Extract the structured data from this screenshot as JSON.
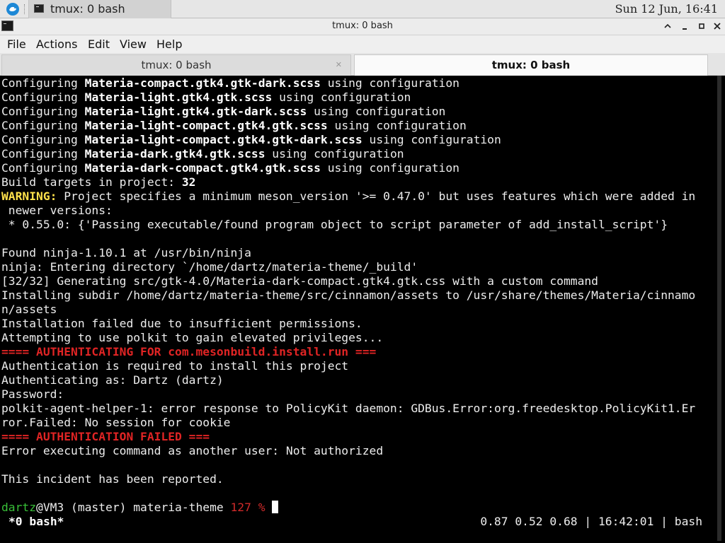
{
  "panel": {
    "launcher_icon": "xfce-launcher-icon",
    "task_title": "tmux: 0 bash",
    "clock": "Sun 12 Jun, 16:41"
  },
  "window": {
    "title": "tmux: 0 bash",
    "buttons": [
      "minimize",
      "maximize",
      "close"
    ]
  },
  "menu": {
    "items": [
      "File",
      "Actions",
      "Edit",
      "View",
      "Help"
    ]
  },
  "tabs": [
    {
      "label": "tmux: 0 bash",
      "active": false
    },
    {
      "label": "tmux: 0 bash",
      "active": true
    }
  ],
  "terminal": {
    "lines": [
      {
        "segments": [
          {
            "t": "Configuring "
          },
          {
            "t": "Materia-compact.gtk4.gtk-dark.scss",
            "s": "b"
          },
          {
            "t": " using configuration"
          }
        ]
      },
      {
        "segments": [
          {
            "t": "Configuring "
          },
          {
            "t": "Materia-light.gtk4.gtk.scss",
            "s": "b"
          },
          {
            "t": " using configuration"
          }
        ]
      },
      {
        "segments": [
          {
            "t": "Configuring "
          },
          {
            "t": "Materia-light.gtk4.gtk-dark.scss",
            "s": "b"
          },
          {
            "t": " using configuration"
          }
        ]
      },
      {
        "segments": [
          {
            "t": "Configuring "
          },
          {
            "t": "Materia-light-compact.gtk4.gtk.scss",
            "s": "b"
          },
          {
            "t": " using configuration"
          }
        ]
      },
      {
        "segments": [
          {
            "t": "Configuring "
          },
          {
            "t": "Materia-light-compact.gtk4.gtk-dark.scss",
            "s": "b"
          },
          {
            "t": " using configuration"
          }
        ]
      },
      {
        "segments": [
          {
            "t": "Configuring "
          },
          {
            "t": "Materia-dark.gtk4.gtk.scss",
            "s": "b"
          },
          {
            "t": " using configuration"
          }
        ]
      },
      {
        "segments": [
          {
            "t": "Configuring "
          },
          {
            "t": "Materia-dark-compact.gtk4.gtk.scss",
            "s": "b"
          },
          {
            "t": " using configuration"
          }
        ]
      },
      {
        "segments": [
          {
            "t": "Build targets in project: "
          },
          {
            "t": "32",
            "s": "b"
          }
        ]
      },
      {
        "segments": [
          {
            "t": "WARNING:",
            "s": "warn"
          },
          {
            "t": " Project specifies a minimum meson_version '>= 0.47.0' but uses features which were added in"
          }
        ]
      },
      {
        "segments": [
          {
            "t": " newer versions:"
          }
        ]
      },
      {
        "segments": [
          {
            "t": " * 0.55.0: {'Passing executable/found program object to script parameter of add_install_script'}"
          }
        ]
      },
      {
        "segments": [
          {
            "t": ""
          }
        ]
      },
      {
        "segments": [
          {
            "t": "Found ninja-1.10.1 at /usr/bin/ninja"
          }
        ]
      },
      {
        "segments": [
          {
            "t": "ninja: Entering directory `/home/dartz/materia-theme/_build'"
          }
        ]
      },
      {
        "segments": [
          {
            "t": "[32/32] Generating src/gtk-4.0/Materia-dark-compact.gtk4.gtk.css with a custom command"
          }
        ]
      },
      {
        "segments": [
          {
            "t": "Installing subdir /home/dartz/materia-theme/src/cinnamon/assets to /usr/share/themes/Materia/cinnamo"
          }
        ]
      },
      {
        "segments": [
          {
            "t": "n/assets"
          }
        ]
      },
      {
        "segments": [
          {
            "t": "Installation failed due to insufficient permissions."
          }
        ]
      },
      {
        "segments": [
          {
            "t": "Attempting to use polkit to gain elevated privileges..."
          }
        ]
      },
      {
        "segments": [
          {
            "t": "==== AUTHENTICATING FOR com.mesonbuild.install.run ===",
            "s": "red"
          }
        ]
      },
      {
        "segments": [
          {
            "t": "Authentication is required to install this project"
          }
        ]
      },
      {
        "segments": [
          {
            "t": "Authenticating as: Dartz (dartz)"
          }
        ]
      },
      {
        "segments": [
          {
            "t": "Password:"
          }
        ]
      },
      {
        "segments": [
          {
            "t": "polkit-agent-helper-1: error response to PolicyKit daemon: GDBus.Error:org.freedesktop.PolicyKit1.Er"
          }
        ]
      },
      {
        "segments": [
          {
            "t": "ror.Failed: No session for cookie"
          }
        ]
      },
      {
        "segments": [
          {
            "t": "==== AUTHENTICATION FAILED ===",
            "s": "red"
          }
        ]
      },
      {
        "segments": [
          {
            "t": "Error executing command as another user: Not authorized"
          }
        ]
      },
      {
        "segments": [
          {
            "t": ""
          }
        ]
      },
      {
        "segments": [
          {
            "t": "This incident has been reported."
          }
        ]
      },
      {
        "segments": [
          {
            "t": ""
          }
        ]
      }
    ],
    "prompt": {
      "user": "dartz",
      "host_branch_dir": "@VM3 (master) materia-theme ",
      "exit_code": "127",
      "symbol": " % "
    }
  },
  "tmux_status": {
    "left": "*0 bash*",
    "right": "0.87 0.52 0.68 | 16:42:01 | bash"
  },
  "colors": {
    "terminal_bg": "#000000",
    "terminal_fg": "#ededed",
    "warning": "#ffe14b",
    "error": "#e02424",
    "prompt_user": "#38c038",
    "exit_code": "#d02a2a"
  }
}
